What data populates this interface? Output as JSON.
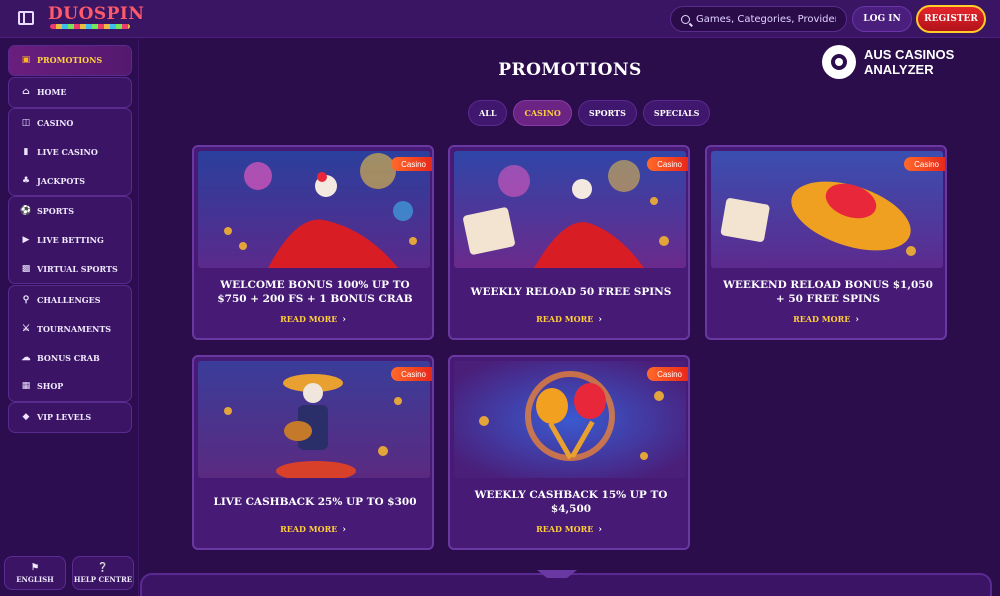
{
  "header": {
    "logo_text": "DUOSPIN",
    "search_placeholder": "Games, Categories, Providers",
    "login_label": "LOG IN",
    "register_label": "REGISTER"
  },
  "sidebar": {
    "groups": [
      [
        {
          "label": "PROMOTIONS",
          "icon": "gift-icon",
          "active": true
        }
      ],
      [
        {
          "label": "HOME",
          "icon": "home-icon"
        }
      ],
      [
        {
          "label": "CASINO",
          "icon": "slot-icon"
        },
        {
          "label": "LIVE CASINO",
          "icon": "card-icon"
        },
        {
          "label": "JACKPOTS",
          "icon": "clover-icon"
        }
      ],
      [
        {
          "label": "SPORTS",
          "icon": "ball-icon"
        },
        {
          "label": "LIVE BETTING",
          "icon": "play-icon"
        },
        {
          "label": "VIRTUAL SPORTS",
          "icon": "monitor-icon"
        }
      ],
      [
        {
          "label": "CHALLENGES",
          "icon": "medal-icon"
        },
        {
          "label": "TOURNAMENTS",
          "icon": "trophy-icon"
        },
        {
          "label": "BONUS CRAB",
          "icon": "crab-icon"
        },
        {
          "label": "SHOP",
          "icon": "bag-icon"
        }
      ],
      [
        {
          "label": "VIP LEVELS",
          "icon": "diamond-icon"
        }
      ]
    ],
    "language_label": "ENGLISH",
    "help_label": "HELP CENTRE"
  },
  "main": {
    "title": "PROMOTIONS",
    "watermark_text": "AUS CASINOS ANALYZER",
    "watermark_line1": "AUS CASINOS",
    "watermark_line2": "ANALYZER",
    "filters": [
      {
        "label": "ALL",
        "active": false
      },
      {
        "label": "CASINO",
        "active": true
      },
      {
        "label": "SPORTS",
        "active": false
      },
      {
        "label": "SPECIALS",
        "active": false
      }
    ],
    "cards": [
      {
        "badge": "Casino",
        "title": "WELCOME BONUS 100% UP TO $750 + 200 FS + 1 BONUS CRAB",
        "cta": "READ MORE"
      },
      {
        "badge": "Casino",
        "title": "WEEKLY RELOAD 50 FREE SPINS",
        "cta": "READ MORE"
      },
      {
        "badge": "Casino",
        "title": "WEEKEND RELOAD BONUS $1,050 + 50 FREE SPINS",
        "cta": "READ MORE"
      },
      {
        "badge": "Casino",
        "title": "LIVE CASHBACK 25% UP TO $300",
        "cta": "READ MORE"
      },
      {
        "badge": "Casino",
        "title": "WEEKLY CASHBACK 15% UP TO $4,500",
        "cta": "READ MORE"
      }
    ]
  },
  "colors": {
    "background": "#2a0d4a",
    "accent_gold": "#ffcf3a",
    "register_red": "#d81d24",
    "badge_orange": "#f04a22"
  }
}
